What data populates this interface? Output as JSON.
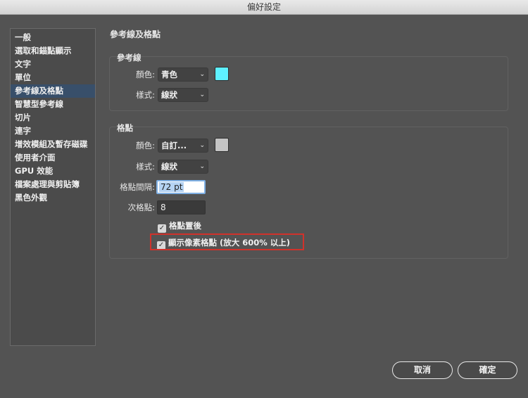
{
  "window": {
    "title": "偏好設定"
  },
  "sidebar": {
    "items": [
      {
        "label": "一般"
      },
      {
        "label": "選取和錨點顯示"
      },
      {
        "label": "文字"
      },
      {
        "label": "單位"
      },
      {
        "label": "參考線及格點",
        "selected": true
      },
      {
        "label": "智慧型參考線"
      },
      {
        "label": "切片"
      },
      {
        "label": "連字"
      },
      {
        "label": "增效模組及暫存磁碟"
      },
      {
        "label": "使用者介面"
      },
      {
        "label": "GPU 效能"
      },
      {
        "label": "檔案處理與剪貼簿"
      },
      {
        "label": "黑色外觀"
      }
    ]
  },
  "main": {
    "section_title": "參考線及格點",
    "guides": {
      "title": "參考線",
      "color_label": "顏色:",
      "color_value": "青色",
      "color_swatch": "#5ef0ff",
      "style_label": "樣式:",
      "style_value": "線狀"
    },
    "grid": {
      "title": "格點",
      "color_label": "顏色:",
      "color_value": "自訂...",
      "color_swatch": "#c4c4c4",
      "style_label": "樣式:",
      "style_value": "線狀",
      "spacing_label": "格點間隔:",
      "spacing_value": "72 pt",
      "subdivisions_label": "次格點:",
      "subdivisions_value": "8",
      "grids_in_back": {
        "label": "格點置後",
        "checked": true
      },
      "show_pixel_grid": {
        "label": "顯示像素格點 (放大 600% 以上)",
        "checked": true
      }
    }
  },
  "buttons": {
    "cancel": "取消",
    "ok": "確定"
  },
  "icons": {
    "dropdown": "chevron-down-icon",
    "check": "checkmark-icon"
  },
  "colors": {
    "highlight_border": "#d0322b",
    "selection": "#384f6a"
  }
}
